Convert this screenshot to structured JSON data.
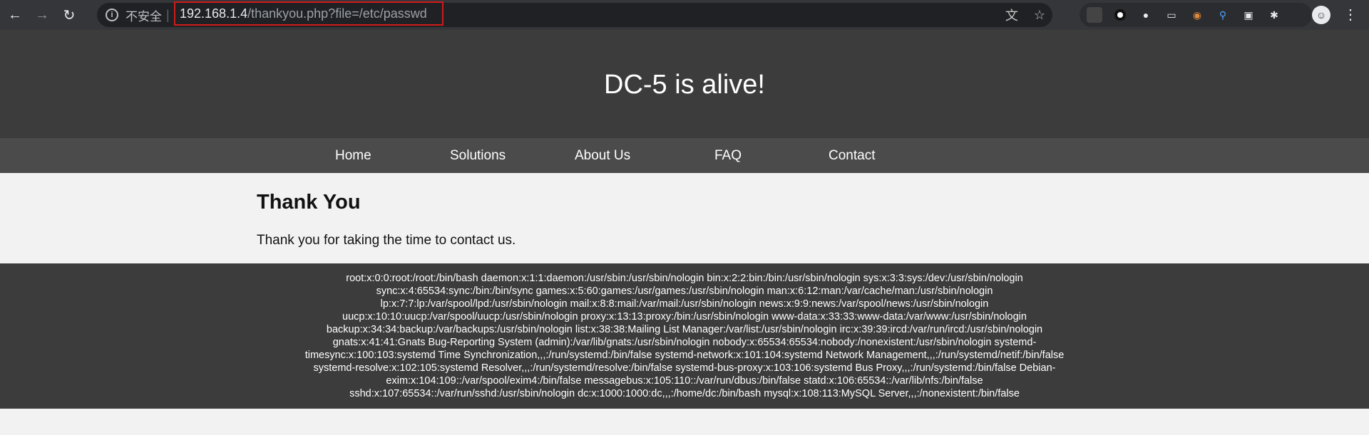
{
  "browser": {
    "security_label": "不安全",
    "url_host": "192.168.1.4",
    "url_path": "/thankyou.php?file=/etc/passwd",
    "icons": [
      "back-icon",
      "forward-icon",
      "reload-icon",
      "info-icon",
      "translate-icon",
      "star-icon",
      "extensions-icon",
      "menu-icon"
    ]
  },
  "site": {
    "title": "DC-5 is alive!",
    "nav": [
      "Home",
      "Solutions",
      "About Us",
      "FAQ",
      "Contact"
    ]
  },
  "main": {
    "heading": "Thank You",
    "text": "Thank you for taking the time to contact us."
  },
  "footer": {
    "lines": [
      "root:x:0:0:root:/root:/bin/bash daemon:x:1:1:daemon:/usr/sbin:/usr/sbin/nologin bin:x:2:2:bin:/bin:/usr/sbin/nologin sys:x:3:3:sys:/dev:/usr/sbin/nologin",
      "sync:x:4:65534:sync:/bin:/bin/sync games:x:5:60:games:/usr/games:/usr/sbin/nologin man:x:6:12:man:/var/cache/man:/usr/sbin/nologin",
      "lp:x:7:7:lp:/var/spool/lpd:/usr/sbin/nologin mail:x:8:8:mail:/var/mail:/usr/sbin/nologin news:x:9:9:news:/var/spool/news:/usr/sbin/nologin",
      "uucp:x:10:10:uucp:/var/spool/uucp:/usr/sbin/nologin proxy:x:13:13:proxy:/bin:/usr/sbin/nologin www-data:x:33:33:www-data:/var/www:/usr/sbin/nologin",
      "backup:x:34:34:backup:/var/backups:/usr/sbin/nologin list:x:38:38:Mailing List Manager:/var/list:/usr/sbin/nologin irc:x:39:39:ircd:/var/run/ircd:/usr/sbin/nologin",
      "gnats:x:41:41:Gnats Bug-Reporting System (admin):/var/lib/gnats:/usr/sbin/nologin nobody:x:65534:65534:nobody:/nonexistent:/usr/sbin/nologin systemd-",
      "timesync:x:100:103:systemd Time Synchronization,,,:/run/systemd:/bin/false systemd-network:x:101:104:systemd Network Management,,,:/run/systemd/netif:/bin/false",
      "systemd-resolve:x:102:105:systemd Resolver,,,:/run/systemd/resolve:/bin/false systemd-bus-proxy:x:103:106:systemd Bus Proxy,,,:/run/systemd:/bin/false Debian-",
      "exim:x:104:109::/var/spool/exim4:/bin/false messagebus:x:105:110::/var/run/dbus:/bin/false statd:x:106:65534::/var/lib/nfs:/bin/false",
      "sshd:x:107:65534::/var/run/sshd:/usr/sbin/nologin dc:x:1000:1000:dc,,,:/home/dc:/bin/bash mysql:x:108:113:MySQL Server,,,:/nonexistent:/bin/false"
    ]
  }
}
